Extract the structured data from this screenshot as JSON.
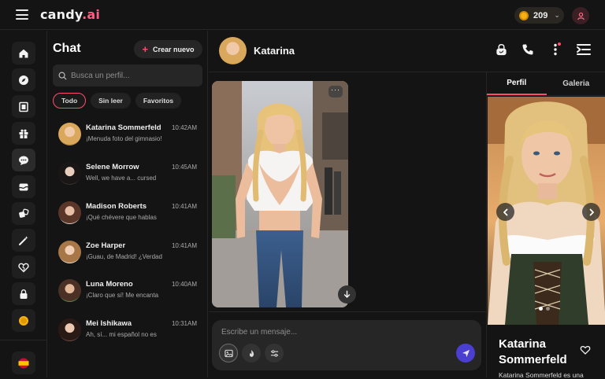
{
  "app": {
    "logo_main": "candy",
    "logo_suffix": ".ai",
    "coins": "209"
  },
  "rail": {
    "items": [
      "home-icon",
      "compass-icon",
      "film-icon",
      "gift-icon",
      "chat-bubble-icon",
      "cards-icon",
      "dice-icon",
      "magic-wand-icon",
      "heart-icon",
      "lock-icon",
      "coin-icon"
    ],
    "active": "chat-bubble-icon",
    "language_flag": "flag-es-icon"
  },
  "chatlist": {
    "title": "Chat",
    "new_button": "Crear nuevo",
    "search_placeholder": "Busca un perfil...",
    "filters": [
      "Todo",
      "Sin leer",
      "Favoritos"
    ],
    "active_filter": "Todo",
    "conversations": [
      {
        "name": "Katarina Sommerfeld",
        "time": "10:42AM",
        "preview": "¡Menuda foto del gimnasio!",
        "avatar_color": "#d9a85c"
      },
      {
        "name": "Selene Morrow",
        "time": "10:45AM",
        "preview": "Well, we have a... cursed",
        "avatar_color": "#3a3030"
      },
      {
        "name": "Madison Roberts",
        "time": "10:41AM",
        "preview": "¡Qué chévere que hablas",
        "avatar_color": "#8a5a44"
      },
      {
        "name": "Zoe Harper",
        "time": "10:41AM",
        "preview": "¡Guau, de Madrid! ¿Verdad",
        "avatar_color": "#c99a6a"
      },
      {
        "name": "Luna Moreno",
        "time": "10:40AM",
        "preview": "¡Claro que sí! Me encanta",
        "avatar_color": "#6b4a3a"
      },
      {
        "name": "Mei Ishikawa",
        "time": "10:31AM",
        "preview": "Ah, sí... mi español no es",
        "avatar_color": "#4a3530"
      }
    ]
  },
  "chat": {
    "contact_name": "Katarina",
    "header_icons": [
      "lock-icon",
      "phone-icon",
      "more-vertical-icon",
      "collapse-panel-icon"
    ],
    "composer_placeholder": "Escribe un mensaje...",
    "composer_tools": [
      "image-icon",
      "fire-icon",
      "sliders-icon"
    ]
  },
  "profile": {
    "tabs": [
      "Perfil",
      "Galeria"
    ],
    "active_tab": "Perfil",
    "name": "Katarina Sommerfeld",
    "description": "Katarina Sommerfeld es una",
    "gallery_dots": 2,
    "gallery_active": 0
  },
  "colors": {
    "accent": "#ff4d6d",
    "send": "#4a3fd0",
    "bg": "#141414",
    "surface": "#262626"
  }
}
